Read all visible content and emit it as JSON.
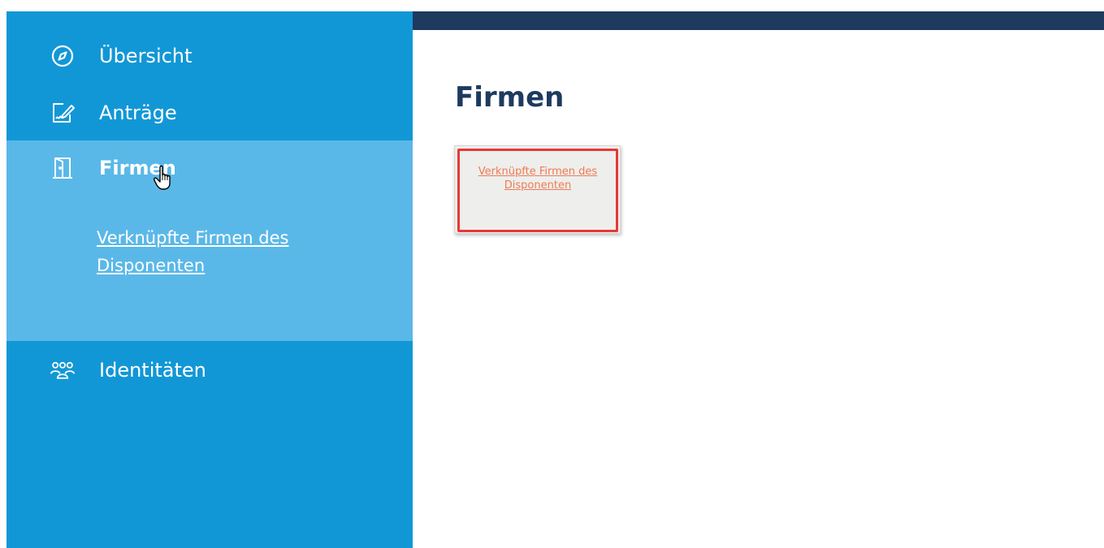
{
  "sidebar": {
    "items": [
      {
        "label": "Übersicht",
        "icon": "compass-icon"
      },
      {
        "label": "Anträge",
        "icon": "document-pen-icon"
      },
      {
        "label": "Firmen",
        "icon": "door-icon"
      },
      {
        "label": "Identitäten",
        "icon": "people-group-icon"
      }
    ],
    "active_sub_link": "Verknüpfte Firmen des Disponenten"
  },
  "main": {
    "title": "Firmen",
    "tile_link": "Verknüpfte Firmen des Disponenten"
  },
  "colors": {
    "sidebar": "#1297d6",
    "sidebar_active": "#5ab8e8",
    "header": "#1e3a5f",
    "title": "#1e3a5f",
    "tile_link": "#ef7a52",
    "highlight": "#e53935"
  }
}
